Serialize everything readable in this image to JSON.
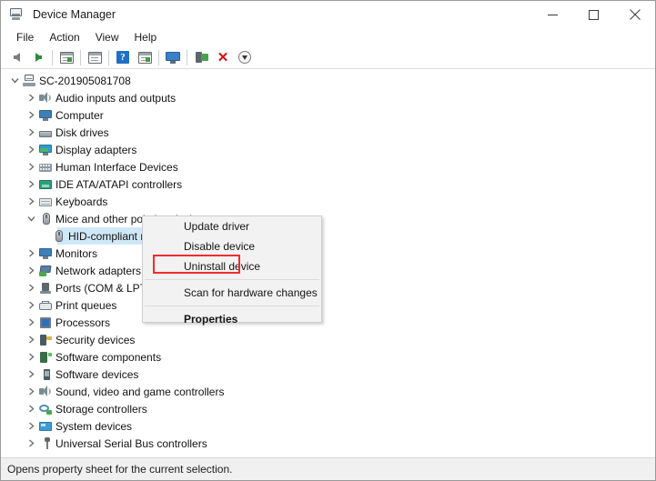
{
  "window": {
    "title": "Device Manager",
    "icon": "computer-icon",
    "controls": {
      "minimize": "minimize-icon",
      "maximize": "maximize-icon",
      "close": "close-icon"
    }
  },
  "menubar": {
    "items": [
      {
        "label": "File"
      },
      {
        "label": "Action"
      },
      {
        "label": "View"
      },
      {
        "label": "Help"
      }
    ]
  },
  "toolbar": {
    "buttons": [
      {
        "icon": "back-arrow-icon"
      },
      {
        "icon": "forward-arrow-icon"
      },
      {
        "icon": "properties-icon"
      },
      {
        "icon": "update-driver-icon"
      },
      {
        "icon": "help-icon"
      },
      {
        "icon": "show-hidden-devices-icon"
      },
      {
        "icon": "scan-hardware-icon"
      },
      {
        "icon": "update-device-driver-icon"
      },
      {
        "icon": "uninstall-device-icon"
      },
      {
        "icon": "disable-device-icon"
      }
    ]
  },
  "tree": {
    "root": {
      "label": "SC-201905081708",
      "icon": "computer-root-icon",
      "expanded": true
    },
    "items": [
      {
        "label": "Audio inputs and outputs",
        "icon": "speaker-icon",
        "expandable": true,
        "expanded": false,
        "selected": false,
        "indent": 1
      },
      {
        "label": "Computer",
        "icon": "monitor-icon",
        "expandable": true,
        "expanded": false,
        "selected": false,
        "indent": 1
      },
      {
        "label": "Disk drives",
        "icon": "disk-drive-icon",
        "expandable": true,
        "expanded": false,
        "selected": false,
        "indent": 1
      },
      {
        "label": "Display adapters",
        "icon": "display-adapter-icon",
        "expandable": true,
        "expanded": false,
        "selected": false,
        "indent": 1
      },
      {
        "label": "Human Interface Devices",
        "icon": "hid-icon",
        "expandable": true,
        "expanded": false,
        "selected": false,
        "indent": 1
      },
      {
        "label": "IDE ATA/ATAPI controllers",
        "icon": "ide-controller-icon",
        "expandable": true,
        "expanded": false,
        "selected": false,
        "indent": 1
      },
      {
        "label": "Keyboards",
        "icon": "keyboard-icon",
        "expandable": true,
        "expanded": false,
        "selected": false,
        "indent": 1
      },
      {
        "label": "Mice and other pointing devices",
        "icon": "mouse-icon",
        "expandable": true,
        "expanded": true,
        "selected": false,
        "indent": 1
      },
      {
        "label": "HID-compliant mouse",
        "icon": "mouse-icon",
        "expandable": false,
        "expanded": false,
        "selected": true,
        "indent": 2
      },
      {
        "label": "Monitors",
        "icon": "monitor-icon",
        "expandable": true,
        "expanded": false,
        "selected": false,
        "indent": 1
      },
      {
        "label": "Network adapters",
        "icon": "network-adapter-icon",
        "expandable": true,
        "expanded": false,
        "selected": false,
        "indent": 1
      },
      {
        "label": "Ports (COM & LPT)",
        "icon": "port-icon",
        "expandable": true,
        "expanded": false,
        "selected": false,
        "indent": 1
      },
      {
        "label": "Print queues",
        "icon": "printer-icon",
        "expandable": true,
        "expanded": false,
        "selected": false,
        "indent": 1
      },
      {
        "label": "Processors",
        "icon": "processor-icon",
        "expandable": true,
        "expanded": false,
        "selected": false,
        "indent": 1
      },
      {
        "label": "Security devices",
        "icon": "security-device-icon",
        "expandable": true,
        "expanded": false,
        "selected": false,
        "indent": 1
      },
      {
        "label": "Software components",
        "icon": "software-component-icon",
        "expandable": true,
        "expanded": false,
        "selected": false,
        "indent": 1
      },
      {
        "label": "Software devices",
        "icon": "software-device-icon",
        "expandable": true,
        "expanded": false,
        "selected": false,
        "indent": 1
      },
      {
        "label": "Sound, video and game controllers",
        "icon": "speaker-icon",
        "expandable": true,
        "expanded": false,
        "selected": false,
        "indent": 1
      },
      {
        "label": "Storage controllers",
        "icon": "storage-controller-icon",
        "expandable": true,
        "expanded": false,
        "selected": false,
        "indent": 1
      },
      {
        "label": "System devices",
        "icon": "system-device-icon",
        "expandable": true,
        "expanded": false,
        "selected": false,
        "indent": 1
      },
      {
        "label": "Universal Serial Bus controllers",
        "icon": "usb-controller-icon",
        "expandable": true,
        "expanded": false,
        "selected": false,
        "indent": 1
      }
    ]
  },
  "context_menu": {
    "items": [
      {
        "label": "Update driver",
        "bold": false,
        "separator_after": false
      },
      {
        "label": "Disable device",
        "bold": false,
        "separator_after": false
      },
      {
        "label": "Uninstall device",
        "bold": false,
        "separator_after": true
      },
      {
        "label": "Scan for hardware changes",
        "bold": false,
        "separator_after": true
      },
      {
        "label": "Properties",
        "bold": true,
        "separator_after": false
      }
    ],
    "highlight": {
      "target_label": "Uninstall device",
      "color": "#ef2d2d"
    }
  },
  "statusbar": {
    "text": "Opens property sheet for the current selection."
  },
  "colors": {
    "selection": "#cfe8f7",
    "annotation": "#ef2d2d",
    "menu_bg": "#f2f2f2",
    "status_bg": "#f0f0f0",
    "window_bg": "#ffffff"
  }
}
